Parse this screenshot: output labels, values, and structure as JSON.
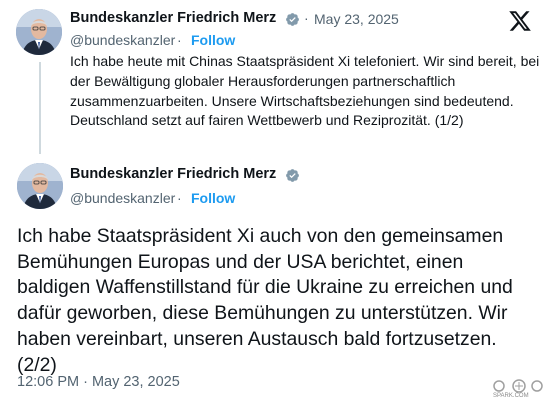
{
  "tweet1": {
    "author_name": "Bundeskanzler Friedrich Merz",
    "separator": "·",
    "date": "May 23, 2025",
    "handle": "@bundeskanzler",
    "follow_label": "Follow",
    "text": "Ich habe heute mit Chinas Staatspräsident Xi telefoniert. Wir sind bereit, bei der Bewältigung globaler Herausforderungen partnerschaftlich zusammenzuarbeiten. Unsere Wirtschaftsbeziehungen sind bedeutend. Deutschland setzt auf fairen Wettbewerb und Reziprozität. (1/2)"
  },
  "tweet2": {
    "author_name": "Bundeskanzler Friedrich Merz",
    "handle": "@bundeskanzler",
    "follow_label": "Follow",
    "text": "Ich habe Staatspräsident Xi auch von den gemeinsamen Bemühungen Europas und der USA berichtet, einen baldigen Waffenstillstand für die Ukraine zu erreichen und dafür geworben, diese Bemühungen zu unterstützen. Wir haben vereinbart, unseren Austausch bald fortzusetzen. (2/2)",
    "timestamp": "12:06 PM · May 23, 2025"
  },
  "icons": {
    "verified": "verified-badge-icon",
    "brand": "x-logo-icon"
  },
  "watermark": {
    "text": "SPARK.COM"
  },
  "colors": {
    "accent": "#1d9bf0",
    "muted": "#536471",
    "text": "#0f1419"
  }
}
